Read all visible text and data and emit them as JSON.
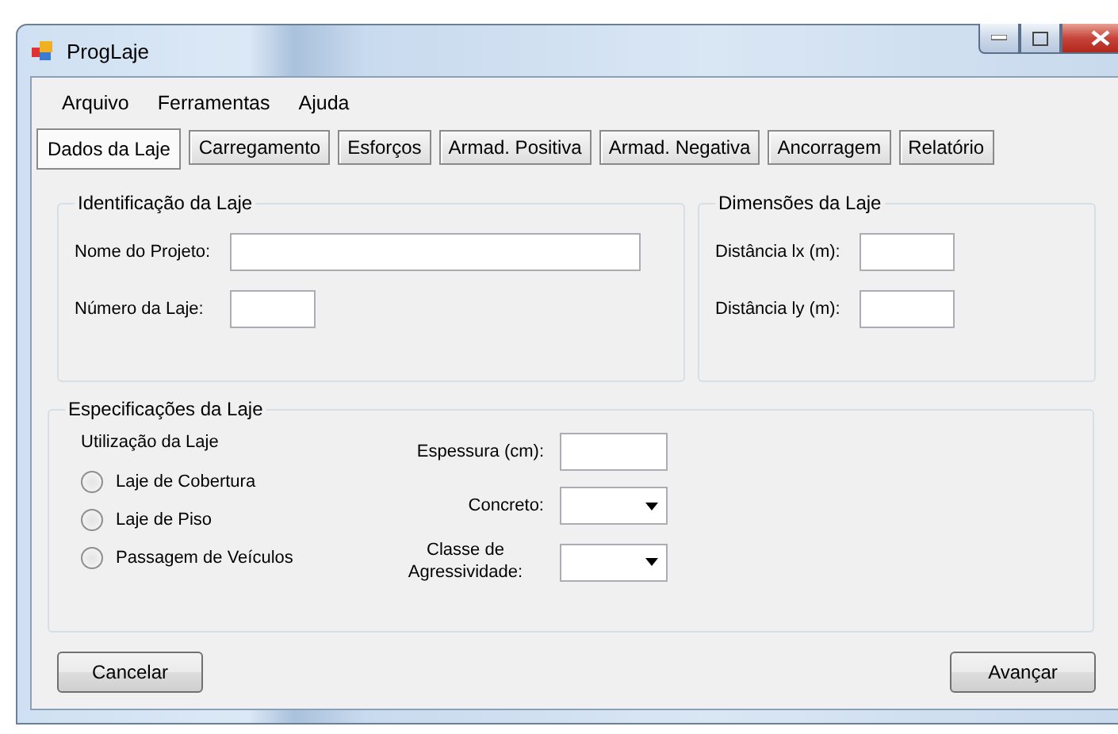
{
  "window": {
    "title": "ProgLaje"
  },
  "menu": [
    "Arquivo",
    "Ferramentas",
    "Ajuda"
  ],
  "tabs": [
    {
      "label": "Dados da Laje",
      "selected": true
    },
    {
      "label": "Carregamento",
      "selected": false
    },
    {
      "label": "Esforços",
      "selected": false
    },
    {
      "label": "Armad. Positiva",
      "selected": false
    },
    {
      "label": "Armad. Negativa",
      "selected": false
    },
    {
      "label": "Ancorragem",
      "selected": false
    },
    {
      "label": "Relatório",
      "selected": false
    }
  ],
  "identificacao": {
    "title": "Identificação da Laje",
    "fields": [
      {
        "label": "Nome do Projeto:",
        "kind": "wide"
      },
      {
        "label": "Número da Laje:",
        "kind": "short"
      }
    ]
  },
  "dimensoes": {
    "title": "Dimensões da Laje",
    "fields": [
      {
        "label": "Distância lx (m):",
        "kind": "short"
      },
      {
        "label": "Distância ly (m):",
        "kind": "short"
      }
    ]
  },
  "especificacoes": {
    "title": "Especificações da Laje",
    "utilizacao": {
      "label": "Utilização da Laje",
      "options": [
        {
          "label": "Laje de Cobertura",
          "selected": false
        },
        {
          "label": "Laje de Piso",
          "selected": false
        },
        {
          "label": "Passagem de Veículos",
          "selected": false
        }
      ]
    },
    "fields": [
      {
        "label": "Espessura (cm):",
        "kind": "text"
      },
      {
        "label": "Concreto:",
        "kind": "dropdown"
      },
      {
        "label": "Classe de Agressividade:",
        "kind": "dropdown"
      }
    ]
  },
  "buttons": [
    {
      "label": "Cancelar"
    },
    {
      "label": "Avançar"
    }
  ]
}
